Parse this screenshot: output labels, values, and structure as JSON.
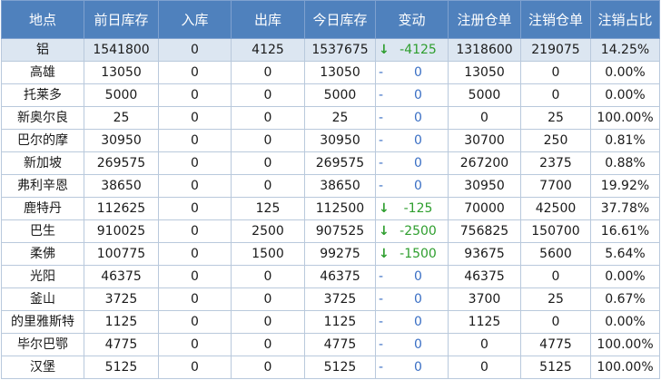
{
  "colors": {
    "header_bg": "#4f81bd",
    "header_text": "#ffffff",
    "highlight_row": "#dce6f1",
    "grid_line": "#b9c9dc",
    "decrease": "#2e9e2e",
    "unchanged": "#3a6fc4"
  },
  "table": {
    "columns": [
      "地点",
      "前日库存",
      "入库",
      "出库",
      "今日库存",
      "变动",
      "注册仓单",
      "注销仓单",
      "注销占比"
    ],
    "rows": [
      {
        "location": "铝",
        "prev": "1541800",
        "in": "0",
        "out": "4125",
        "today": "1537675",
        "arrow": "↓",
        "trend": "down",
        "change": "-4125",
        "registered": "1318600",
        "cancelled": "219075",
        "ratio": "14.25%",
        "highlight": true
      },
      {
        "location": "高雄",
        "prev": "13050",
        "in": "0",
        "out": "0",
        "today": "13050",
        "arrow": "-",
        "trend": "flat",
        "change": "0",
        "registered": "13050",
        "cancelled": "0",
        "ratio": "0.00%"
      },
      {
        "location": "托莱多",
        "prev": "5000",
        "in": "0",
        "out": "0",
        "today": "5000",
        "arrow": "-",
        "trend": "flat",
        "change": "0",
        "registered": "5000",
        "cancelled": "0",
        "ratio": "0.00%"
      },
      {
        "location": "新奥尔良",
        "prev": "25",
        "in": "0",
        "out": "0",
        "today": "25",
        "arrow": "-",
        "trend": "flat",
        "change": "0",
        "registered": "0",
        "cancelled": "25",
        "ratio": "100.00%"
      },
      {
        "location": "巴尔的摩",
        "prev": "30950",
        "in": "0",
        "out": "0",
        "today": "30950",
        "arrow": "-",
        "trend": "flat",
        "change": "0",
        "registered": "30700",
        "cancelled": "250",
        "ratio": "0.81%"
      },
      {
        "location": "新加坡",
        "prev": "269575",
        "in": "0",
        "out": "0",
        "today": "269575",
        "arrow": "-",
        "trend": "flat",
        "change": "0",
        "registered": "267200",
        "cancelled": "2375",
        "ratio": "0.88%"
      },
      {
        "location": "弗利辛恩",
        "prev": "38650",
        "in": "0",
        "out": "0",
        "today": "38650",
        "arrow": "-",
        "trend": "flat",
        "change": "0",
        "registered": "30950",
        "cancelled": "7700",
        "ratio": "19.92%"
      },
      {
        "location": "鹿特丹",
        "prev": "112625",
        "in": "0",
        "out": "125",
        "today": "112500",
        "arrow": "↓",
        "trend": "down",
        "change": "-125",
        "registered": "70000",
        "cancelled": "42500",
        "ratio": "37.78%"
      },
      {
        "location": "巴生",
        "prev": "910025",
        "in": "0",
        "out": "2500",
        "today": "907525",
        "arrow": "↓",
        "trend": "down",
        "change": "-2500",
        "registered": "756825",
        "cancelled": "150700",
        "ratio": "16.61%"
      },
      {
        "location": "柔佛",
        "prev": "100775",
        "in": "0",
        "out": "1500",
        "today": "99275",
        "arrow": "↓",
        "trend": "down",
        "change": "-1500",
        "registered": "93675",
        "cancelled": "5600",
        "ratio": "5.64%"
      },
      {
        "location": "光阳",
        "prev": "46375",
        "in": "0",
        "out": "0",
        "today": "46375",
        "arrow": "-",
        "trend": "flat",
        "change": "0",
        "registered": "46375",
        "cancelled": "0",
        "ratio": "0.00%"
      },
      {
        "location": "釜山",
        "prev": "3725",
        "in": "0",
        "out": "0",
        "today": "3725",
        "arrow": "-",
        "trend": "flat",
        "change": "0",
        "registered": "3700",
        "cancelled": "25",
        "ratio": "0.67%"
      },
      {
        "location": "的里雅斯特",
        "prev": "1125",
        "in": "0",
        "out": "0",
        "today": "1125",
        "arrow": "-",
        "trend": "flat",
        "change": "0",
        "registered": "1125",
        "cancelled": "0",
        "ratio": "0.00%"
      },
      {
        "location": "毕尔巴鄂",
        "prev": "4775",
        "in": "0",
        "out": "0",
        "today": "4775",
        "arrow": "-",
        "trend": "flat",
        "change": "0",
        "registered": "0",
        "cancelled": "4775",
        "ratio": "100.00%"
      },
      {
        "location": "汉堡",
        "prev": "5125",
        "in": "0",
        "out": "0",
        "today": "5125",
        "arrow": "-",
        "trend": "flat",
        "change": "0",
        "registered": "0",
        "cancelled": "5125",
        "ratio": "100.00%"
      }
    ]
  }
}
